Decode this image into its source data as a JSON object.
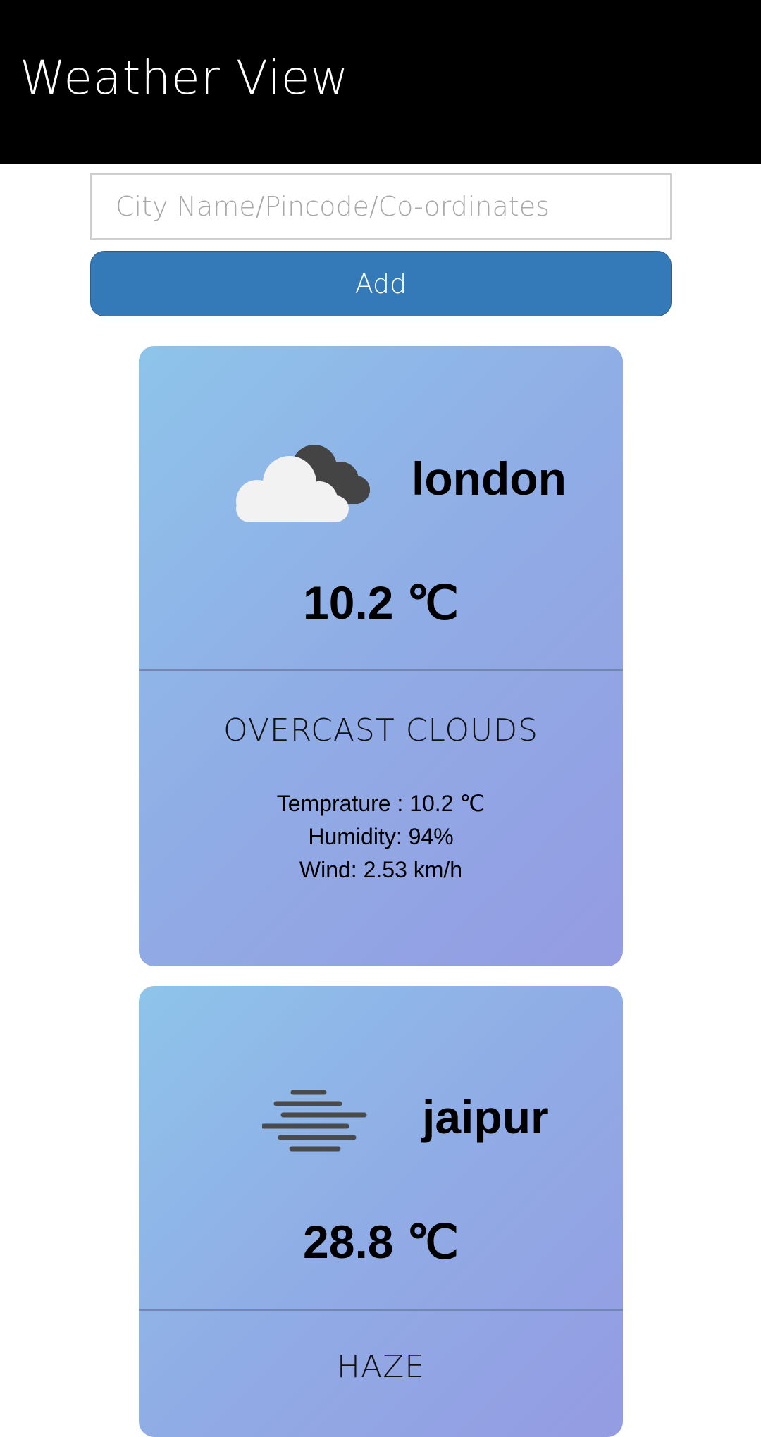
{
  "header": {
    "title": "Weather View"
  },
  "search": {
    "placeholder": "City Name/Pincode/Co-ordinates",
    "value": ""
  },
  "add_button": {
    "label": "Add"
  },
  "cards": [
    {
      "city": "london",
      "icon": "overcast-clouds-icon",
      "temperature": "10.2 ℃",
      "description": "OVERCAST CLOUDS",
      "details": {
        "temperature": "Temprature : 10.2 ℃",
        "humidity": "Humidity: 94%",
        "wind": "Wind: 2.53 km/h"
      }
    },
    {
      "city": "jaipur",
      "icon": "haze-icon",
      "temperature": "28.8 ℃",
      "description": "HAZE"
    }
  ],
  "colors": {
    "header_bg": "#000000",
    "button_bg": "#357ab8",
    "card_gradient_start": "#8ec4ea",
    "card_gradient_end": "#949be2"
  }
}
